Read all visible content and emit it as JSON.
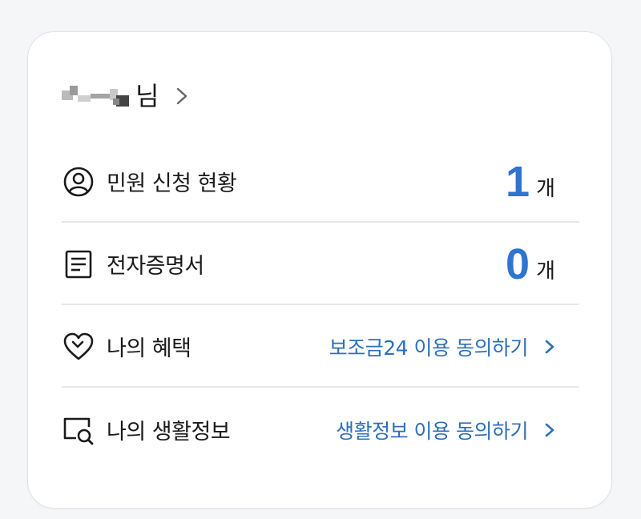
{
  "header": {
    "user_name_suffix": "님"
  },
  "rows": [
    {
      "label": "민원 신청 현황",
      "icon": "person-circle-icon",
      "count": "1",
      "unit": "개"
    },
    {
      "label": "전자증명서",
      "icon": "document-icon",
      "count": "0",
      "unit": "개"
    },
    {
      "label": "나의 혜택",
      "icon": "heart-icon",
      "link": "보조금24 이용 동의하기"
    },
    {
      "label": "나의 생활정보",
      "icon": "search-window-icon",
      "link": "생활정보 이용 동의하기"
    }
  ],
  "colors": {
    "accent_number": "#2f74d0",
    "link": "#2d6fb8",
    "divider": "#e5e7ea"
  }
}
